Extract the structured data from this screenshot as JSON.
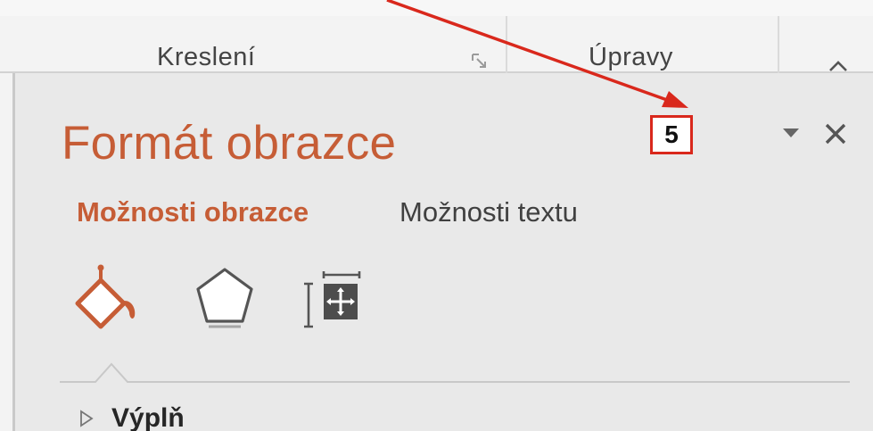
{
  "ribbon": {
    "groups": [
      {
        "label": "Kreslení"
      },
      {
        "label": "Úpravy"
      }
    ]
  },
  "pane": {
    "title": "Formát obrazce",
    "tabs": [
      {
        "label": "Možnosti obrazce",
        "active": true
      },
      {
        "label": "Možnosti textu",
        "active": false
      }
    ],
    "icon_buttons": [
      {
        "icon": "fill-line-icon",
        "active": true
      },
      {
        "icon": "effects-pentagon-icon",
        "active": false
      },
      {
        "icon": "size-properties-icon",
        "active": false
      }
    ],
    "sections": [
      {
        "label": "Výplň",
        "expanded": false
      }
    ]
  },
  "callout": {
    "label": "5",
    "color": "#d9281c"
  },
  "colors": {
    "accent": "#c65d36",
    "pane_background": "#e9e9e9",
    "ribbon_background": "#f3f3f3"
  }
}
